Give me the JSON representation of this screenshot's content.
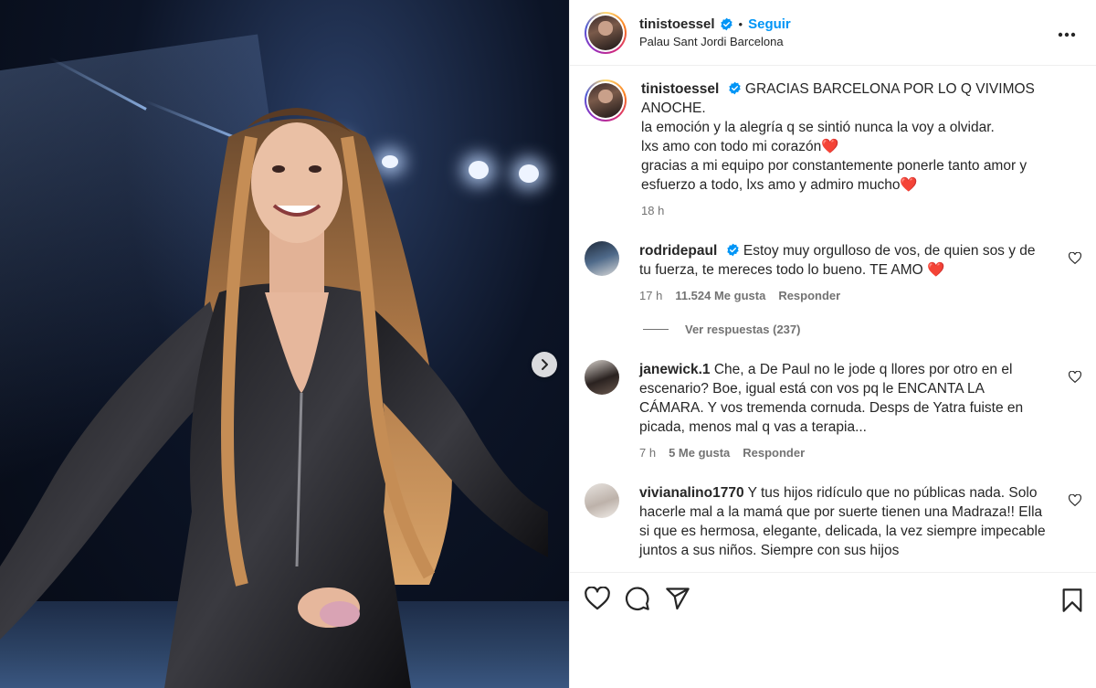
{
  "post": {
    "author": "tinistoessel",
    "follow_label": "Seguir",
    "separator": "•",
    "location": "Palau Sant Jordi Barcelona",
    "caption": {
      "username": "tinistoessel",
      "lines": [
        "GRACIAS BARCELONA POR LO Q VIVIMOS ANOCHE.",
        "la emoción y la alegría q se sintió nunca la voy a olvidar.",
        "lxs amo con todo mi corazón❤️",
        "gracias a mi equipo por constantemente ponerle tanto amor y esfuerzo a todo, lxs amo y admiro mucho❤️"
      ],
      "time": "18 h"
    }
  },
  "comments": [
    {
      "username": "rodridepaul",
      "verified": true,
      "text": "Estoy muy orgulloso de vos, de quien sos y de tu fuerza, te mereces todo lo bueno. TE AMO ❤️",
      "time": "17 h",
      "likes": "11.524 Me gusta",
      "reply": "Responder",
      "view_replies": "Ver respuestas (237)"
    },
    {
      "username": "janewick.1",
      "verified": false,
      "text": "Che, a De Paul no le jode q llores por otro en el escenario? Boe, igual está con vos pq le ENCANTA LA CÁMARA. Y vos tremenda cornuda. Desps de Yatra fuiste en picada, menos mal q vas a terapia...",
      "time": "7 h",
      "likes": "5 Me gusta",
      "reply": "Responder"
    },
    {
      "username": "vivianalino1770",
      "verified": false,
      "text": "Y tus hijos ridículo que no públicas nada. Solo hacerle mal a la mamá que por suerte tienen una Madraza!! Ella si que es hermosa, elegante, delicada, la vez siempre impecable juntos a sus niños. Siempre con sus hijos"
    }
  ],
  "icons": {
    "like": "heart-icon",
    "comment": "comment-icon",
    "share": "share-icon",
    "save": "bookmark-icon",
    "more": "more-options-icon",
    "next": "chevron-right-icon",
    "verified": "verified-badge-icon"
  },
  "colors": {
    "follow": "#0095f6",
    "verified": "#0095f6",
    "heart_emoji": "#e0245e",
    "text": "#262626",
    "muted": "#737373"
  }
}
